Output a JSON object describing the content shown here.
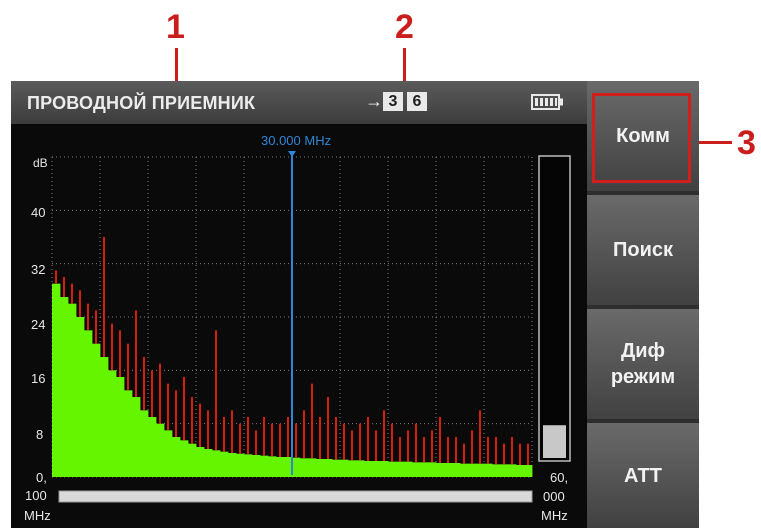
{
  "callouts": {
    "one": "1",
    "two": "2",
    "three": "3"
  },
  "header": {
    "title": "ПРОВОДНОЙ ПРИЕМНИК",
    "arrow": "→",
    "input_from": "3",
    "input_to": "6",
    "battery_icon": "battery-full-icon"
  },
  "side_buttons": {
    "comm": "Комм",
    "search": "Поиск",
    "diff_line1": "Диф",
    "diff_line2": "режим",
    "att": "АТТ"
  },
  "marker": {
    "frequency": "30.000 MHz"
  },
  "y_axis": {
    "unit": "dB",
    "ticks": [
      "40",
      "32",
      "24",
      "16",
      "8",
      "0,"
    ]
  },
  "x_axis": {
    "start_value": "100",
    "start_unit": "MHz",
    "end_value_1": "60,",
    "end_value_2": "000",
    "end_unit": "MHz"
  },
  "level_bar": {
    "level": 0.11
  },
  "colors": {
    "spectrum_fill": "#66f500",
    "spectrum_peak": "#d61e0f",
    "marker": "#2f86d6",
    "callout": "#cc1d1d"
  },
  "chart_data": {
    "type": "area",
    "ylabel": "dB",
    "ylim": [
      0,
      48
    ],
    "yticks": [
      0,
      8,
      16,
      24,
      32,
      40
    ],
    "x_range_labels": [
      "100 MHz",
      "60,000 MHz"
    ],
    "marker_label": "30.000 MHz",
    "series": [
      {
        "values": [
          29,
          27,
          26,
          24,
          22,
          20,
          18,
          16,
          15,
          13,
          12,
          10,
          9,
          8,
          7,
          6,
          5.5,
          5,
          4.5,
          4.2,
          4,
          3.8,
          3.6,
          3.5,
          3.4,
          3.3,
          3.2,
          3.1,
          3,
          3,
          2.9,
          2.8,
          2.8,
          2.7,
          2.7,
          2.6,
          2.6,
          2.5,
          2.5,
          2.4,
          2.4,
          2.4,
          2.3,
          2.3,
          2.3,
          2.2,
          2.2,
          2.2,
          2.1,
          2.1,
          2.1,
          2,
          2,
          2,
          2,
          1.9,
          1.9,
          1.9,
          1.8,
          1.8
        ]
      },
      {
        "values": [
          31,
          30,
          29,
          28,
          26,
          25,
          36,
          23,
          22,
          20,
          25,
          18,
          16,
          17,
          14,
          13,
          15,
          12,
          11,
          10,
          22,
          9,
          10,
          8,
          9,
          7,
          9,
          8,
          8,
          9,
          8,
          10,
          14,
          9,
          12,
          9,
          8,
          7,
          8,
          9,
          7,
          10,
          8,
          6,
          7,
          8,
          6,
          7,
          9,
          6,
          6,
          5,
          7,
          10,
          6,
          6,
          5,
          6,
          5,
          5
        ]
      }
    ]
  }
}
